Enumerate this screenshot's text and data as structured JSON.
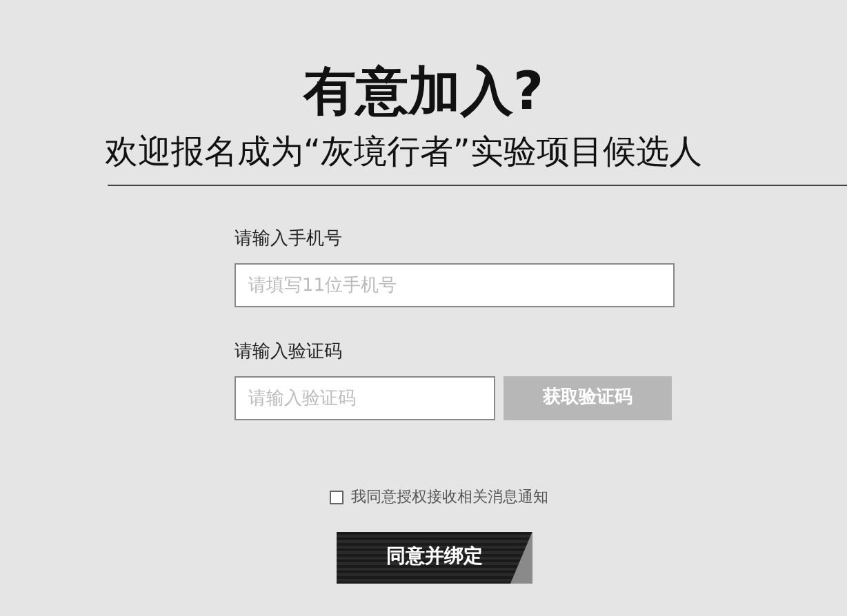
{
  "heading": {
    "title": "有意加入?",
    "subtitle": "欢迎报名成为“灰境行者”实验项目候选人"
  },
  "form": {
    "phone": {
      "label": "请输入手机号",
      "placeholder": "请填写11位手机号"
    },
    "code": {
      "label": "请输入验证码",
      "placeholder": "请输入验证码",
      "button": "获取验证码"
    },
    "consent": {
      "label": "我同意授权接收相关消息通知",
      "checked": false
    },
    "submit": "同意并绑定"
  }
}
